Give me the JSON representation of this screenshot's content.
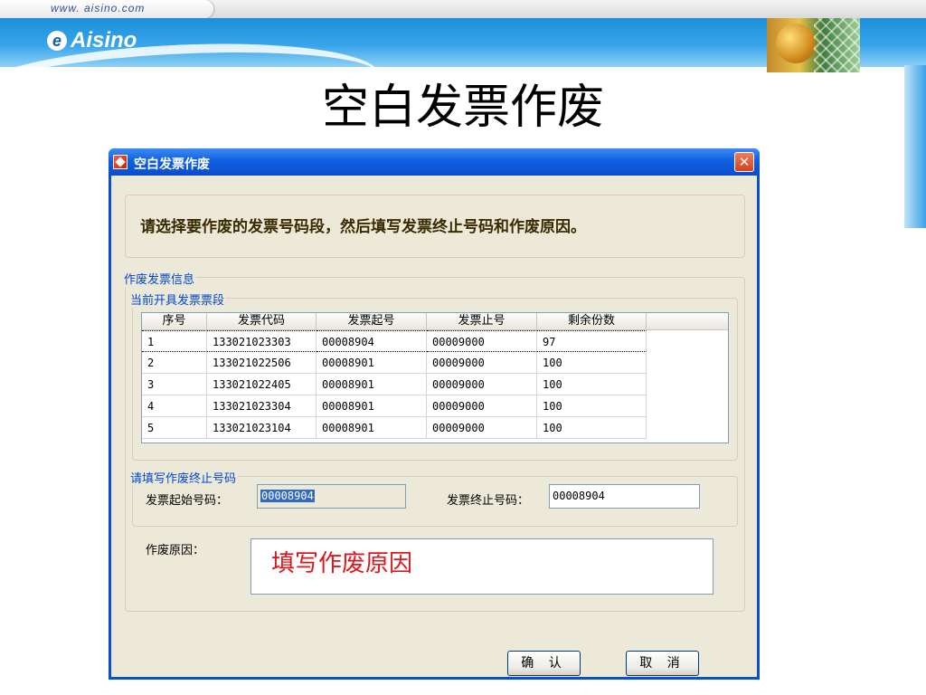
{
  "slide": {
    "url": "www. aisino.com",
    "logo_text": "Aisino",
    "logo_mark": "e",
    "title": "空白发票作废"
  },
  "dialog": {
    "title": "空白发票作废",
    "close_glyph": "✕",
    "instruction": "请选择要作废的发票号码段，然后填写发票终止号码和作废原因。",
    "info_group_label": "作废发票信息",
    "segment_group_label": "当前开具发票票段",
    "table": {
      "headers": [
        "序号",
        "发票代码",
        "发票起号",
        "发票止号",
        "剩余份数",
        ""
      ],
      "rows": [
        [
          "1",
          "133021023303",
          "00008904",
          "00009000",
          "97"
        ],
        [
          "2",
          "133021022506",
          "00008901",
          "00009000",
          "100"
        ],
        [
          "3",
          "133021022405",
          "00008901",
          "00009000",
          "100"
        ],
        [
          "4",
          "133021023304",
          "00008901",
          "00009000",
          "100"
        ],
        [
          "5",
          "133021023104",
          "00008901",
          "00009000",
          "100"
        ]
      ],
      "selected_row": 0
    },
    "stop_group_label": "请填写作废终止号码",
    "start_no_label": "发票起始号码：",
    "start_no_value": "00008904",
    "end_no_label": "发票终止号码：",
    "end_no_value": "00008904",
    "reason_label": "作废原因：",
    "reason_value": "填写作废原因",
    "ok_label": "确 认",
    "cancel_label": "取 消"
  },
  "colors": {
    "titlebar": "#0a4ecb",
    "legend_text": "#0046d5",
    "reason_text": "#e0161a",
    "selection": "#316ac5"
  }
}
